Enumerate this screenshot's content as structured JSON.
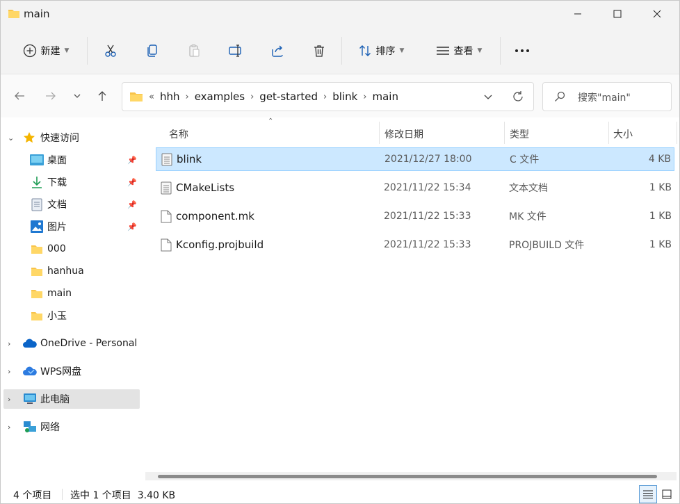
{
  "window": {
    "title": "main",
    "minimize_icon": "minimize-icon",
    "maximize_icon": "maximize-icon",
    "close_icon": "close-icon"
  },
  "toolbar": {
    "new_label": "新建",
    "sort_label": "排序",
    "view_label": "查看",
    "icons": [
      "add-circle-icon",
      "cut-icon",
      "copy-icon",
      "paste-icon",
      "rename-icon",
      "share-icon",
      "delete-icon",
      "sort-icon",
      "view-icon",
      "more-icon"
    ]
  },
  "nav": {
    "back_icon": "arrow-left-icon",
    "forward_icon": "arrow-right-icon",
    "recent_icon": "chevron-down-icon",
    "up_icon": "arrow-up-icon"
  },
  "address": {
    "overflow": "«",
    "breadcrumbs": [
      "hhh",
      "examples",
      "get-started",
      "blink",
      "main"
    ],
    "separator": "›"
  },
  "search": {
    "placeholder": "搜索\"main\""
  },
  "sidebar": {
    "quick_access": "快速访问",
    "pinned": [
      {
        "label": "桌面",
        "icon": "desktop-icon"
      },
      {
        "label": "下载",
        "icon": "download-icon"
      },
      {
        "label": "文档",
        "icon": "document-icon"
      },
      {
        "label": "图片",
        "icon": "picture-icon"
      }
    ],
    "folders": [
      "000",
      "hanhua",
      "main",
      "小玉"
    ],
    "roots": [
      {
        "label": "OneDrive - Personal",
        "icon": "onedrive-icon"
      },
      {
        "label": "WPS网盘",
        "icon": "wps-cloud-icon"
      },
      {
        "label": "此电脑",
        "icon": "computer-icon"
      },
      {
        "label": "网络",
        "icon": "network-icon"
      }
    ]
  },
  "columns": {
    "name": "名称",
    "date": "修改日期",
    "type": "类型",
    "size": "大小"
  },
  "files": [
    {
      "name": "blink",
      "date": "2021/12/27 18:00",
      "type": "C 文件",
      "size": "4 KB",
      "icon": "text-file-icon"
    },
    {
      "name": "CMakeLists",
      "date": "2021/11/22 15:34",
      "type": "文本文档",
      "size": "1 KB",
      "icon": "text-file-icon"
    },
    {
      "name": "component.mk",
      "date": "2021/11/22 15:33",
      "type": "MK 文件",
      "size": "1 KB",
      "icon": "blank-file-icon"
    },
    {
      "name": "Kconfig.projbuild",
      "date": "2021/11/22 15:33",
      "type": "PROJBUILD 文件",
      "size": "1 KB",
      "icon": "blank-file-icon"
    }
  ],
  "status": {
    "item_count": "4 个项目",
    "selection": "选中 1 个项目  3.40 KB"
  },
  "colors": {
    "selection_bg": "#cce8ff",
    "selection_border": "#99d1ff",
    "folder": "#f8c34a",
    "accent": "#0067c0"
  }
}
